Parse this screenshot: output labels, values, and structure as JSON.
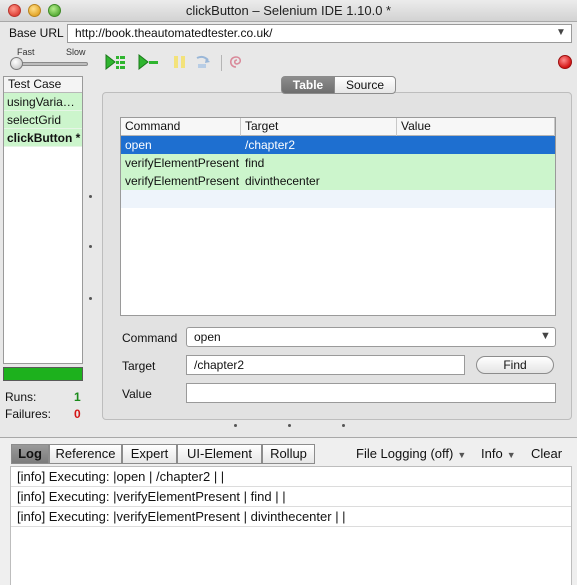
{
  "window": {
    "title": "clickButton – Selenium IDE 1.10.0 *"
  },
  "url_bar": {
    "label": "Base URL",
    "value": "http://book.theautomatedtester.co.uk/"
  },
  "toolbar": {
    "speed_fast": "Fast",
    "speed_slow": "Slow",
    "speed_level": 0
  },
  "test_cases": {
    "header": "Test Case",
    "items": [
      {
        "label": "usingVaria…"
      },
      {
        "label": "selectGrid"
      },
      {
        "label": "clickButton *"
      }
    ]
  },
  "stats": {
    "progress_percent": 100,
    "runs_label": "Runs:",
    "runs_value": "1",
    "failures_label": "Failures:",
    "failures_value": "0"
  },
  "view_tabs": {
    "table": "Table",
    "source": "Source",
    "active": "Table"
  },
  "command_table": {
    "headers": [
      "Command",
      "Target",
      "Value"
    ],
    "rows": [
      {
        "command": "open",
        "target": "/chapter2",
        "value": ""
      },
      {
        "command": "verifyElementPresent",
        "target": "find",
        "value": ""
      },
      {
        "command": "verifyElementPresent",
        "target": "divinthecenter",
        "value": ""
      }
    ]
  },
  "editor": {
    "command_label": "Command",
    "command_value": "open",
    "target_label": "Target",
    "target_value": "/chapter2",
    "find_label": "Find",
    "value_label": "Value",
    "value_value": ""
  },
  "log_panel": {
    "tabs": [
      "Log",
      "Reference",
      "Expert",
      "UI-Element",
      "Rollup"
    ],
    "active_tab": "Log",
    "file_logging": "File Logging (off)",
    "level": "Info",
    "clear": "Clear",
    "lines": [
      "[info] Executing: |open | /chapter2 | |",
      "[info] Executing: |verifyElementPresent | find | |",
      "[info] Executing: |verifyElementPresent | divinthecenter | |"
    ]
  },
  "colors": {
    "pass_row": "#ccf5cc",
    "selected_row": "#1e6fd0",
    "progress": "#1db11d",
    "runs": "#1a8a1a",
    "failures": "#d41414",
    "record": "#d41414"
  }
}
